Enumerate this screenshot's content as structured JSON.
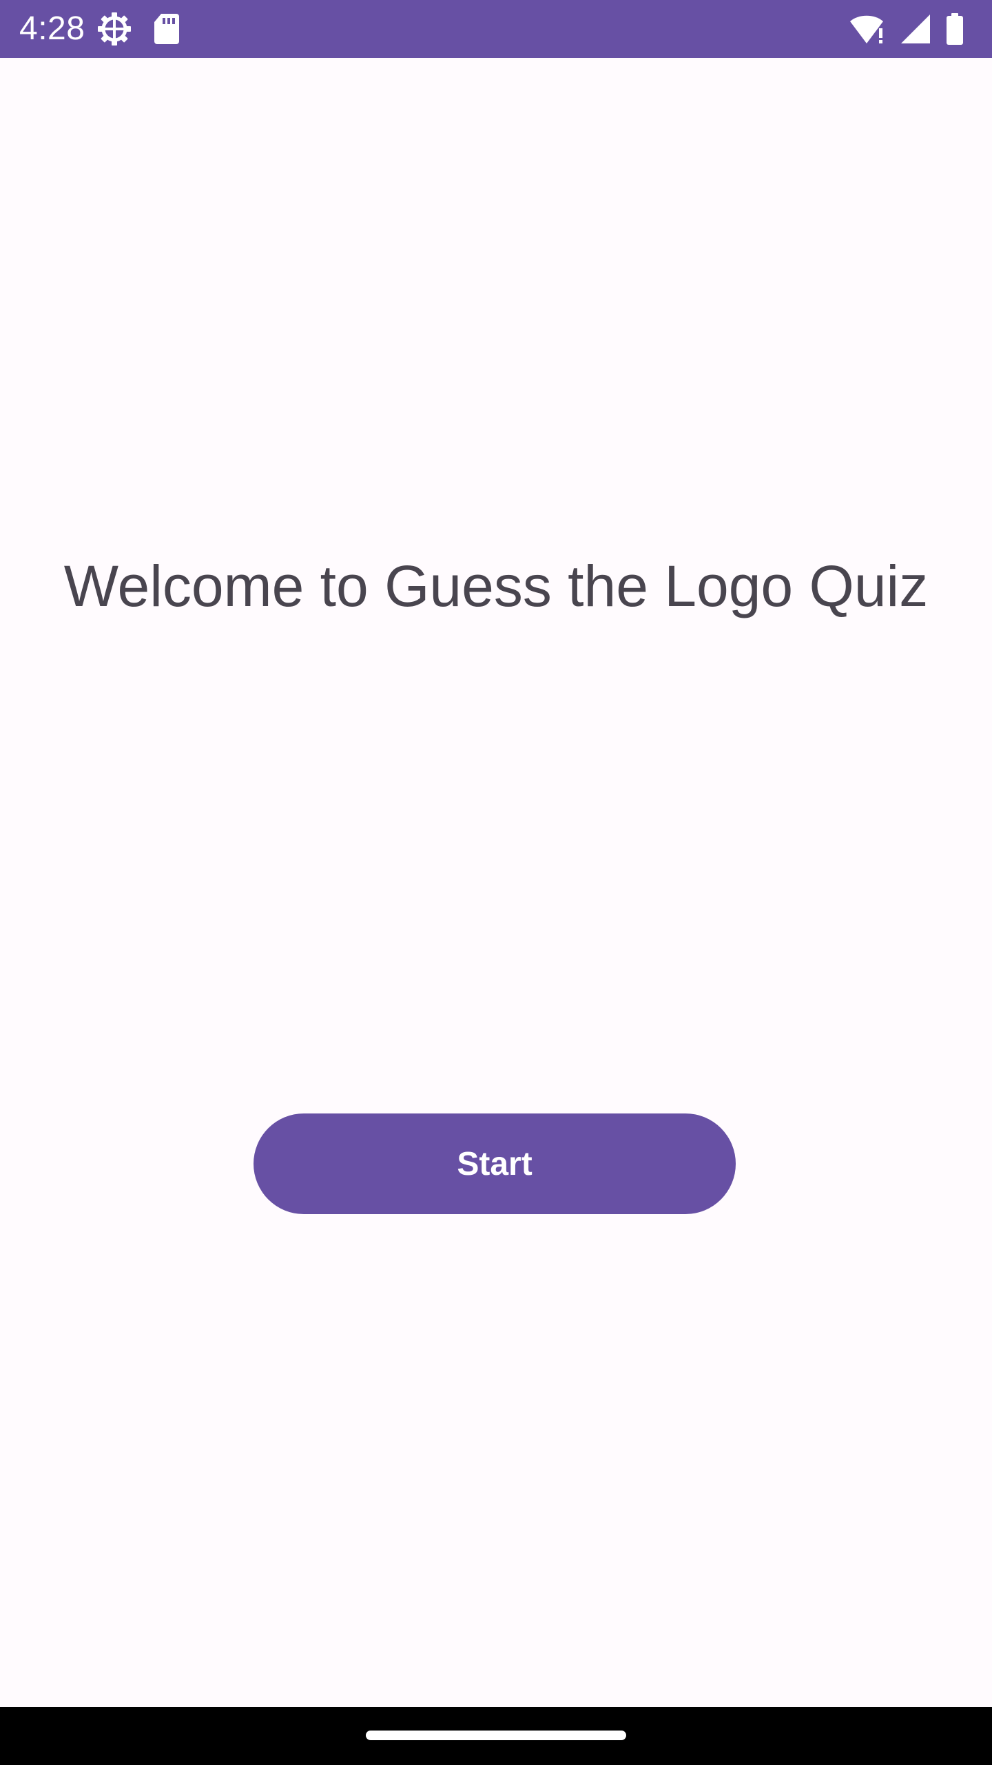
{
  "status_bar": {
    "time": "4:28",
    "background": "#6750A4",
    "icons_left": [
      "settings-gear-icon",
      "sd-card-icon"
    ],
    "icons_right": [
      "wifi-alert-icon",
      "cellular-signal-icon",
      "battery-icon"
    ]
  },
  "main": {
    "title": "Welcome to Guess the Logo Quiz",
    "start_label": "Start"
  },
  "colors": {
    "primary": "#6750A4",
    "background": "#FFFBFE",
    "title_text": "#49454F",
    "nav_bar": "#000000"
  }
}
